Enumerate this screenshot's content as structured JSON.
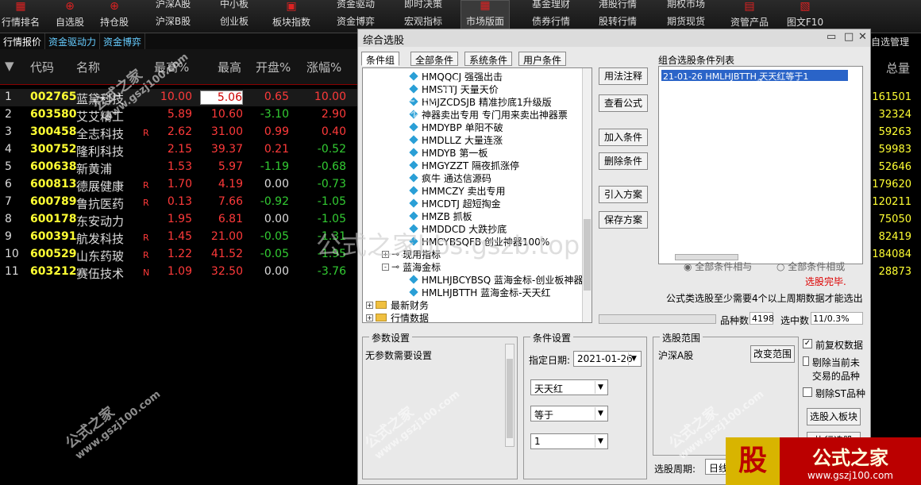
{
  "toolbar": {
    "buttons": [
      {
        "label": "行情排名",
        "icon": "ranking-icon"
      },
      {
        "label": "自选股",
        "icon": "plus-icon"
      },
      {
        "label": "持仓股",
        "icon": "plus-icon"
      }
    ],
    "pairs": [
      {
        "top": "沪深A股",
        "bottom": "沪深B股"
      },
      {
        "top": "中小板",
        "bottom": "创业板"
      },
      {
        "top": "",
        "bottom": "板块指数"
      },
      {
        "top": "资金驱动",
        "bottom": "资金博弈"
      },
      {
        "top": "即时决策",
        "bottom": "宏观指标"
      },
      {
        "top": "",
        "bottom": "市场版面"
      },
      {
        "top": "基金理财",
        "bottom": "债券行情"
      },
      {
        "top": "港股行情",
        "bottom": "股转行情"
      },
      {
        "top": "期权市场",
        "bottom": "期货现货"
      },
      {
        "top": "",
        "bottom": "资管产品"
      },
      {
        "top": "",
        "bottom": "图文F10"
      }
    ]
  },
  "subtabs": [
    "行情报价",
    "资金驱动力",
    "资金博弈"
  ],
  "right_tab": "自选管理",
  "grid": {
    "headers": [
      "代码",
      "名称",
      "最高%",
      "最高",
      "开盘%",
      "涨幅%"
    ],
    "right_header": "总量",
    "rows": [
      {
        "n": "1",
        "code": "002765",
        "name": "蓝黛科技",
        "flag": "",
        "c1": "10.00",
        "c2": "5.06",
        "c3": "0.65",
        "c4": "10.00",
        "vol": "161501"
      },
      {
        "n": "2",
        "code": "603580",
        "name": "艾艾精工",
        "flag": "",
        "c1": "5.89",
        "c2": "10.60",
        "c3": "-3.10",
        "c4": "2.90",
        "vol": "32324"
      },
      {
        "n": "3",
        "code": "300458",
        "name": "全志科技",
        "flag": "R",
        "c1": "2.62",
        "c2": "31.00",
        "c3": "0.99",
        "c4": "0.40",
        "vol": "59263"
      },
      {
        "n": "4",
        "code": "300752",
        "name": "隆利科技",
        "flag": "",
        "c1": "2.15",
        "c2": "39.37",
        "c3": "0.21",
        "c4": "-0.52",
        "vol": "59983"
      },
      {
        "n": "5",
        "code": "600638",
        "name": "新黄浦",
        "flag": "",
        "c1": "1.53",
        "c2": "5.97",
        "c3": "-1.19",
        "c4": "-0.68",
        "vol": "52646"
      },
      {
        "n": "6",
        "code": "600813",
        "name": "德展健康",
        "flag": "R",
        "c1": "1.70",
        "c2": "4.19",
        "c3": "0.00",
        "c4": "-0.73",
        "vol": "179620"
      },
      {
        "n": "7",
        "code": "600789",
        "name": "鲁抗医药",
        "flag": "R",
        "c1": "0.13",
        "c2": "7.66",
        "c3": "-0.92",
        "c4": "-1.05",
        "vol": "120211"
      },
      {
        "n": "8",
        "code": "600178",
        "name": "东安动力",
        "flag": "",
        "c1": "1.95",
        "c2": "6.81",
        "c3": "0.00",
        "c4": "-1.05",
        "vol": "75050"
      },
      {
        "n": "9",
        "code": "600391",
        "name": "航发科技",
        "flag": "R",
        "c1": "1.45",
        "c2": "21.00",
        "c3": "-0.05",
        "c4": "-1.31",
        "vol": "82419"
      },
      {
        "n": "10",
        "code": "600529",
        "name": "山东药玻",
        "flag": "R",
        "c1": "1.22",
        "c2": "41.52",
        "c3": "-0.05",
        "c4": "-1.95",
        "vol": "184084"
      },
      {
        "n": "11",
        "code": "603212",
        "name": "赛伍技术",
        "flag": "N",
        "c1": "1.09",
        "c2": "32.50",
        "c3": "0.00",
        "c4": "-3.76",
        "vol": "28873"
      }
    ]
  },
  "dialog": {
    "title": "综合选股",
    "tabs": [
      "条件组",
      "全部条件",
      "系统条件",
      "用户条件"
    ],
    "tree": [
      {
        "type": "leaf",
        "label": "HMQQCJ 强强出击"
      },
      {
        "type": "leaf",
        "label": "HMSTTJ 天量天价"
      },
      {
        "type": "leaf",
        "label": "HMJZCDSJB 精准抄底1升级版"
      },
      {
        "type": "leaf",
        "label": "神器卖出专用 专门用来卖出神器票"
      },
      {
        "type": "leaf",
        "label": "HMDYBP 单阳不破"
      },
      {
        "type": "leaf",
        "label": "HMDLLZ 大量连涨"
      },
      {
        "type": "leaf",
        "label": "HMDYB 第一板"
      },
      {
        "type": "leaf",
        "label": "HMGYZZT 隔夜抓涨停"
      },
      {
        "type": "leaf",
        "label": "疯牛 通达信源码"
      },
      {
        "type": "leaf",
        "label": "HMMCZY 卖出专用"
      },
      {
        "type": "leaf",
        "label": "HMCDTJ 超短掏金"
      },
      {
        "type": "leaf",
        "label": "HMZB 抓板"
      },
      {
        "type": "leaf",
        "label": "HMDDCD 大跌抄底"
      },
      {
        "type": "leaf",
        "label": "HMCYBSQFB 创业神器100%"
      },
      {
        "type": "group",
        "label": "现用指标",
        "exp": "+"
      },
      {
        "type": "group",
        "label": "蓝海金标",
        "exp": "-"
      },
      {
        "type": "leaf2",
        "label": "HMLHJBCYBSQ 蓝海金标-创业板神器"
      },
      {
        "type": "leaf2",
        "label": "HMLHJBTTH 蓝海金标-天天红"
      },
      {
        "type": "folder",
        "label": "最新财务",
        "exp": "+"
      },
      {
        "type": "folder",
        "label": "行情数据",
        "exp": "+"
      }
    ],
    "buttons": [
      "用法注释",
      "查看公式",
      "加入条件",
      "删除条件",
      "引入方案",
      "保存方案"
    ],
    "combo_label": "组合选股条件列表",
    "combo_item": "21-01-26 HMLHJBTTH 天天红等于1",
    "radio_all": "全部条件相与",
    "radio_any": "全部条件相或",
    "status": "选股完毕.",
    "note": "公式类选股至少需要4个以上周期数据才能选出",
    "count_label1": "品种数",
    "count_val1": "4198",
    "count_label2": "选中数",
    "count_val2": "11/0.3%",
    "param_title": "参数设置",
    "param_text": "无参数需要设置",
    "cond_title": "条件设置",
    "date_label": "指定日期:",
    "date_val": "2021-01-26",
    "cond_field": "天天红",
    "cond_op": "等于",
    "cond_value": "1",
    "range_title": "选股范围",
    "range_val": "沪深A股",
    "range_btn": "改变范围",
    "chk_fq": "前复权数据",
    "chk_suspend": "剔除当前未交易的品种",
    "chk_st": "剔除ST品种",
    "btn_block": "选股入板块",
    "btn_partial": "执行选股",
    "period_label": "选股周期:",
    "period_val": "日线"
  },
  "watermarks": {
    "brand": "公式之家",
    "site": "www.gszj100.com",
    "url": "公式之家bbs.gszb.top"
  },
  "logo": {
    "left": "股",
    "right": "公式之家",
    "url": "www.gszj100.com"
  }
}
